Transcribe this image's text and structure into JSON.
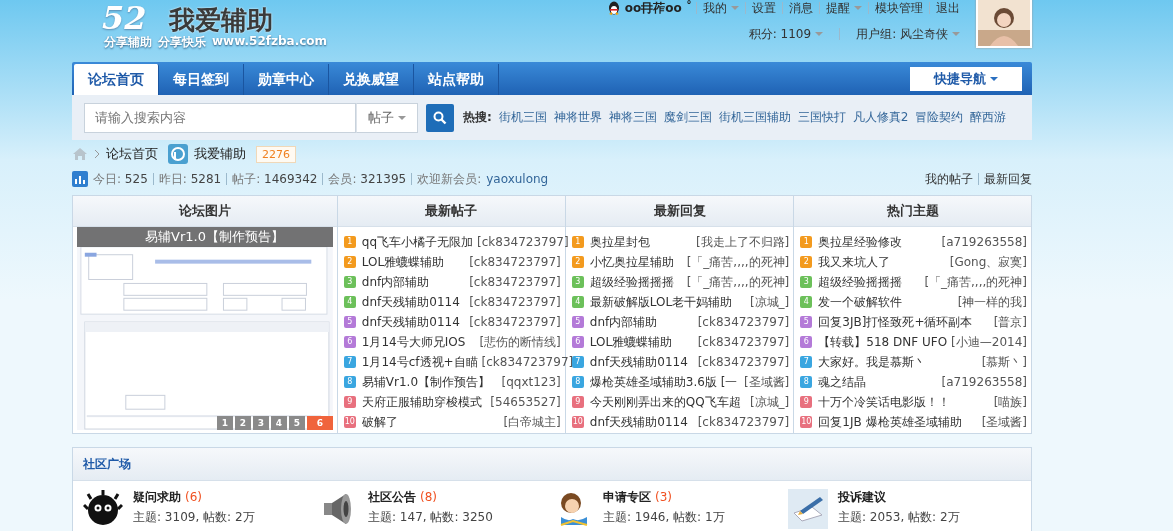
{
  "header": {
    "logo_number": "52",
    "logo_title": "我爱辅助",
    "tagline": [
      "分享辅助",
      "分享快乐",
      "www.52fzba.com"
    ]
  },
  "user": {
    "name": "oo冄莋oo ˚",
    "links": [
      {
        "label": "我的",
        "dropdown": true
      },
      {
        "label": "设置",
        "dropdown": false
      },
      {
        "label": "消息",
        "dropdown": false
      },
      {
        "label": "提醒",
        "dropdown": true
      },
      {
        "label": "模块管理",
        "dropdown": false
      },
      {
        "label": "退出",
        "dropdown": false
      }
    ],
    "points": "积分: 1109",
    "group": "用户组: 风尘奇侠"
  },
  "nav": {
    "tabs": [
      {
        "label": "论坛首页",
        "selected": true
      },
      {
        "label": "每日签到",
        "selected": false
      },
      {
        "label": "勋章中心",
        "selected": false
      },
      {
        "label": "兑换威望",
        "selected": false
      },
      {
        "label": "站点帮助",
        "selected": false
      }
    ],
    "quick_nav": "快捷导航"
  },
  "search": {
    "placeholder": "请输入搜索内容",
    "scope": "帖子",
    "hot_label": "热搜:",
    "hot": [
      "街机三国",
      "神将世界",
      "神将三国",
      "魔剑三国",
      "街机三国辅助",
      "三国快打",
      "凡人修真2",
      "冒险契约",
      "醉西游"
    ]
  },
  "breadcrumb": {
    "items": [
      "论坛首页"
    ],
    "forum": "我爱辅助",
    "count": "2276"
  },
  "stats": {
    "items": [
      {
        "label": "今日:",
        "value": "525"
      },
      {
        "label": "昨日:",
        "value": "5281"
      },
      {
        "label": "帖子:",
        "value": "1469342"
      },
      {
        "label": "会员:",
        "value": "321395"
      }
    ],
    "welcome": "欢迎新会员:",
    "new_member": "yaoxulong",
    "links": [
      "我的帖子",
      "最新回复"
    ]
  },
  "picture_panel": {
    "title": "论坛图片",
    "caption": "易辅Vr1.0【制作预告】",
    "pages": [
      {
        "label": "1",
        "selected": false
      },
      {
        "label": "2",
        "selected": false
      },
      {
        "label": "3",
        "selected": false
      },
      {
        "label": "4",
        "selected": false
      },
      {
        "label": "5",
        "selected": false
      },
      {
        "label": "6",
        "selected": true
      }
    ]
  },
  "lists": [
    {
      "title": "最新帖子",
      "items": [
        {
          "rank": "1",
          "color": "#f39a1e",
          "title": "qq飞车小橘子无限加",
          "author": "[ck834723797]"
        },
        {
          "rank": "2",
          "color": "#f39a1e",
          "title": "LOL雅蠛蝶辅助",
          "author": "[ck834723797]"
        },
        {
          "rank": "3",
          "color": "#6cc05a",
          "title": "dnf内部辅助",
          "author": "[ck834723797]"
        },
        {
          "rank": "4",
          "color": "#6cc05a",
          "title": "dnf天残辅助0114",
          "author": "[ck834723797]"
        },
        {
          "rank": "5",
          "color": "#b47ad8",
          "title": "dnf天残辅助0114",
          "author": "[ck834723797]"
        },
        {
          "rank": "6",
          "color": "#b47ad8",
          "title": "1月14号大师兄IOS",
          "author": "[悲伤的断情线]"
        },
        {
          "rank": "7",
          "color": "#3aa6e0",
          "title": "1月14号cf透视+自瞄",
          "author": "[ck834723797]"
        },
        {
          "rank": "8",
          "color": "#3aa6e0",
          "title": "易辅Vr1.0【制作预告】",
          "author": "[qqxt123]"
        },
        {
          "rank": "9",
          "color": "#e8707e",
          "title": "天府正服辅助穿梭模式",
          "author": "[54653527]"
        },
        {
          "rank": "10",
          "color": "#e8707e",
          "title": "破解了",
          "author": "[白帝城主]"
        }
      ]
    },
    {
      "title": "最新回复",
      "items": [
        {
          "rank": "1",
          "color": "#f39a1e",
          "title": "奥拉星封包",
          "author": "[我走上了不归路]"
        },
        {
          "rank": "2",
          "color": "#f39a1e",
          "title": "小忆奥拉星辅助",
          "author": "[「_痛苦,,,,的死神]"
        },
        {
          "rank": "3",
          "color": "#6cc05a",
          "title": "超级经验摇摇摇",
          "author": "[「_痛苦,,,,的死神]"
        },
        {
          "rank": "4",
          "color": "#6cc05a",
          "title": "最新破解版LOL老干妈辅助",
          "author": "[凉城_]"
        },
        {
          "rank": "5",
          "color": "#b47ad8",
          "title": "dnf内部辅助",
          "author": "[ck834723797]"
        },
        {
          "rank": "6",
          "color": "#b47ad8",
          "title": "LOL雅蠛蝶辅助",
          "author": "[ck834723797]"
        },
        {
          "rank": "7",
          "color": "#3aa6e0",
          "title": "dnf天残辅助0114",
          "author": "[ck834723797]"
        },
        {
          "rank": "8",
          "color": "#3aa6e0",
          "title": "爆枪英雄圣域辅助3.6版 [一",
          "author": "[圣域酱]"
        },
        {
          "rank": "9",
          "color": "#e8707e",
          "title": "今天刚刚弄出来的QQ飞车超",
          "author": "[凉城_]"
        },
        {
          "rank": "10",
          "color": "#e8707e",
          "title": "dnf天残辅助0114",
          "author": "[ck834723797]"
        }
      ]
    },
    {
      "title": "热门主题",
      "items": [
        {
          "rank": "1",
          "color": "#f39a1e",
          "title": "奥拉星经验修改",
          "author": "[a719263558]"
        },
        {
          "rank": "2",
          "color": "#f39a1e",
          "title": "我又来坑人了",
          "author": "[Gong、寂寞]"
        },
        {
          "rank": "3",
          "color": "#6cc05a",
          "title": "超级经验摇摇摇",
          "author": "[「_痛苦,,,,的死神]"
        },
        {
          "rank": "4",
          "color": "#6cc05a",
          "title": "发一个破解软件",
          "author": "[神一样的我]"
        },
        {
          "rank": "5",
          "color": "#b47ad8",
          "title": "回复3JB]打怪致死+循环副本",
          "author": "[普京]"
        },
        {
          "rank": "6",
          "color": "#b47ad8",
          "title": "【转载】518 DNF UFO",
          "author": "[小迪—2014]"
        },
        {
          "rank": "7",
          "color": "#3aa6e0",
          "title": "大家好。我是慕斯丶",
          "author": "[慕斯丶]"
        },
        {
          "rank": "8",
          "color": "#3aa6e0",
          "title": "魂之结晶",
          "author": "[a719263558]"
        },
        {
          "rank": "9",
          "color": "#e8707e",
          "title": "十万个冷笑话电影版！！",
          "author": "[喵族]"
        },
        {
          "rank": "10",
          "color": "#e8707e",
          "title": "回复1JB 爆枪英雄圣域辅助",
          "author": "[圣域酱]"
        }
      ]
    }
  ],
  "community": {
    "title": "社区广场",
    "forums": [
      {
        "kind": "fuzzball",
        "name": "疑问求助",
        "count": "(6)",
        "stats": "主题: 3109, 帖数: 2万"
      },
      {
        "kind": "speaker",
        "name": "社区公告",
        "count": "(8)",
        "stats": "主题: 147, 帖数: 3250"
      },
      {
        "kind": "reader",
        "name": "申请专区",
        "count": "(3)",
        "stats": "主题: 1946, 帖数: 1万"
      },
      {
        "kind": "pen",
        "name": "投诉建议",
        "stats": "主题: 2053, 帖数: 2万"
      }
    ]
  }
}
